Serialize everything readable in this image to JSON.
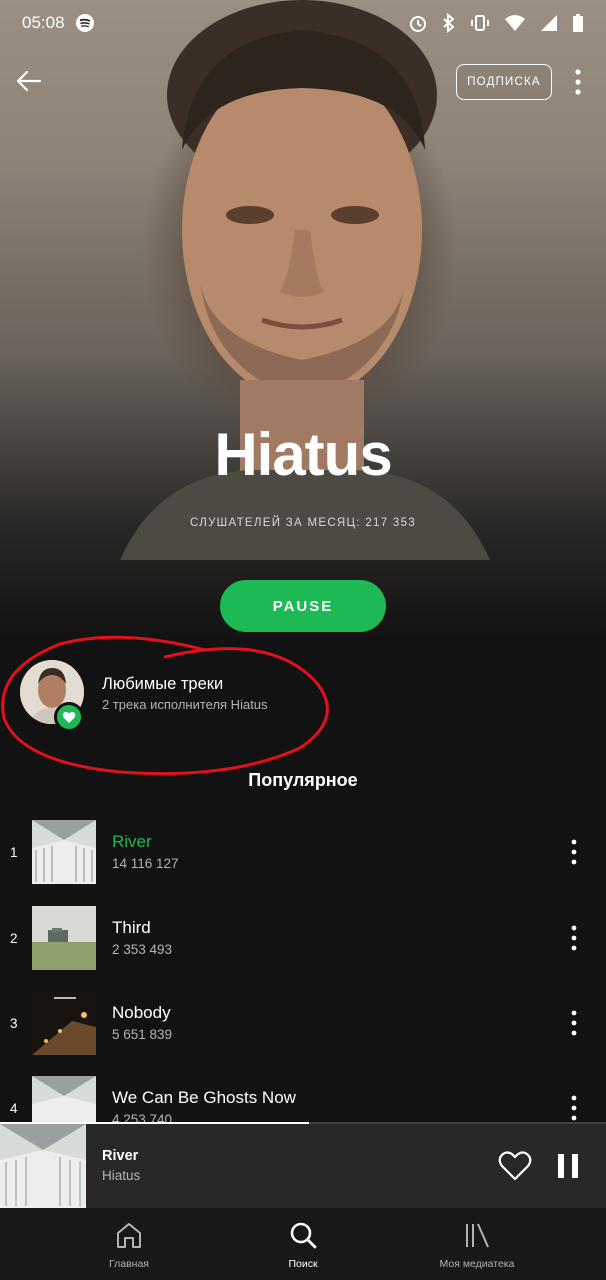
{
  "status_bar": {
    "time": "05:08",
    "icons": [
      "spotify-icon",
      "alarm-icon",
      "bluetooth-icon",
      "vibrate-icon",
      "wifi-icon",
      "signal-icon",
      "battery-icon"
    ]
  },
  "header": {
    "subscribe_label": "ПОДПИСКА"
  },
  "artist": {
    "name": "Hiatus",
    "monthly_listeners": "СЛУШАТЕЛЕЙ ЗА МЕСЯЦ: 217 353"
  },
  "play_button": {
    "label": "PAUSE"
  },
  "liked_tracks": {
    "title": "Любимые треки",
    "subtitle": "2 трека исполнителя Hiatus"
  },
  "popular": {
    "title": "Популярное",
    "tracks": [
      {
        "number": "1",
        "title": "River",
        "plays": "14 116 127",
        "playing": true
      },
      {
        "number": "2",
        "title": "Third",
        "plays": "2 353 493",
        "playing": false
      },
      {
        "number": "3",
        "title": "Nobody",
        "plays": "5 651 839",
        "playing": false
      },
      {
        "number": "4",
        "title": "We Can Be Ghosts Now",
        "plays": "4 253 740",
        "playing": false
      }
    ]
  },
  "now_playing": {
    "title": "River",
    "artist": "Hiatus",
    "progress": 0.51
  },
  "bottom_nav": {
    "items": [
      {
        "label": "Главная",
        "icon": "home-icon",
        "active": false
      },
      {
        "label": "Поиск",
        "icon": "search-icon",
        "active": true
      },
      {
        "label": "Моя медиатека",
        "icon": "library-icon",
        "active": false
      }
    ]
  },
  "colors": {
    "accent": "#1db954",
    "background": "#121212",
    "annotation": "#e0101c"
  }
}
